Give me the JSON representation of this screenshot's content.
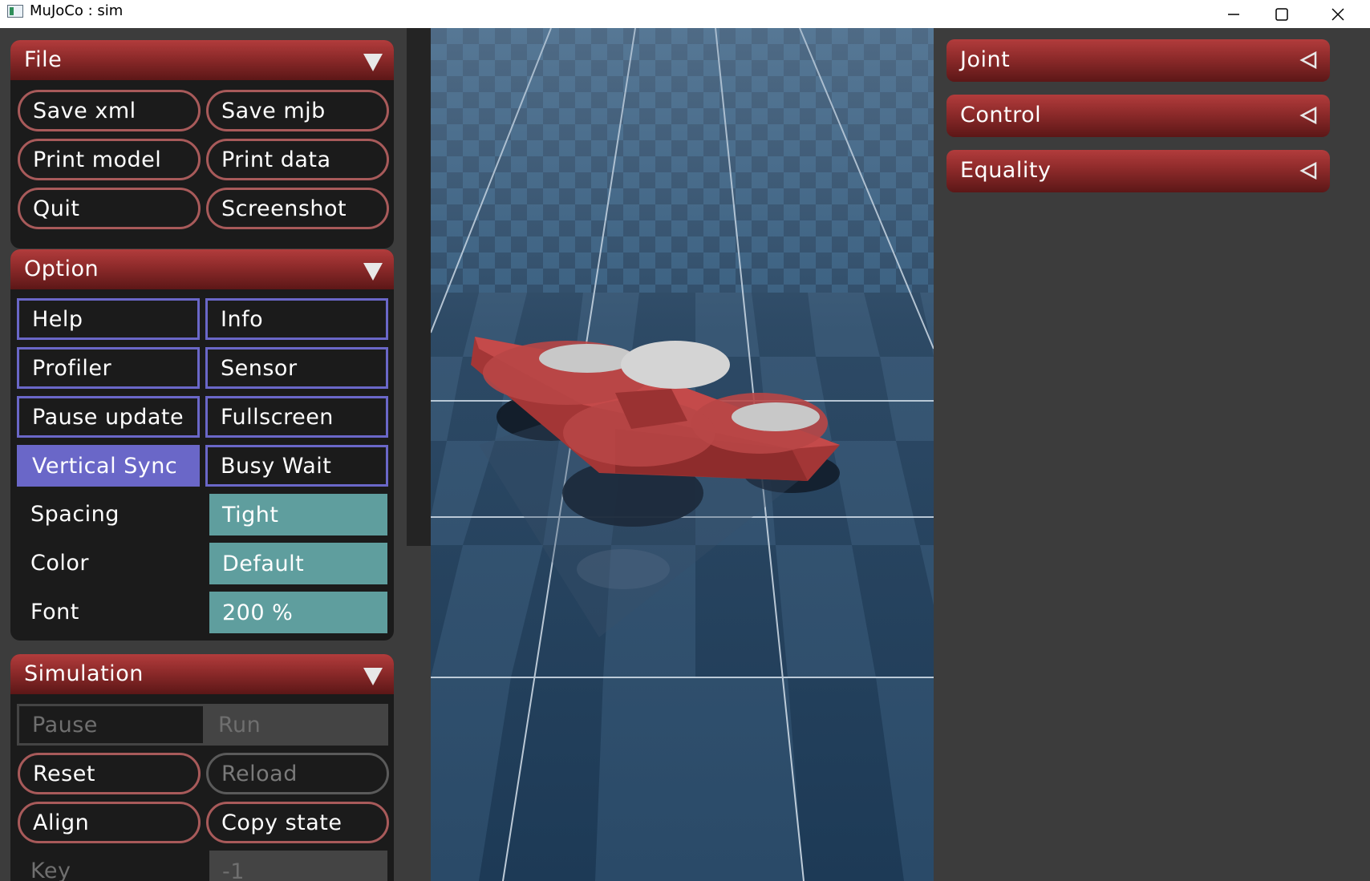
{
  "window": {
    "title": "MuJoCo : sim"
  },
  "left": {
    "file": {
      "title": "File",
      "buttons": [
        "Save xml",
        "Save mjb",
        "Print model",
        "Print data",
        "Quit",
        "Screenshot"
      ]
    },
    "option": {
      "title": "Option",
      "checks": [
        "Help",
        "Info",
        "Profiler",
        "Sensor",
        "Pause update",
        "Fullscreen",
        "Vertical Sync",
        "Busy Wait"
      ],
      "vertical_sync_on": true,
      "spacing_label": "Spacing",
      "spacing_value": "Tight",
      "color_label": "Color",
      "color_value": "Default",
      "font_label": "Font",
      "font_value": "200 %"
    },
    "simulation": {
      "title": "Simulation",
      "pause": "Pause",
      "run": "Run",
      "reset": "Reset",
      "reload": "Reload",
      "align": "Align",
      "copy_state": "Copy state",
      "key_label": "Key",
      "key_value": "-1"
    }
  },
  "right": {
    "sections": [
      "Joint",
      "Control",
      "Equality"
    ]
  },
  "colors": {
    "header_red": "#8d2a2a",
    "check_purple": "#6a67c8",
    "select_teal": "#5f9e9e",
    "pill_border": "#a85a5a"
  },
  "icons": [
    "app-icon",
    "minimize-icon",
    "maximize-icon",
    "close-icon",
    "caret-down-icon",
    "caret-left-icon"
  ]
}
